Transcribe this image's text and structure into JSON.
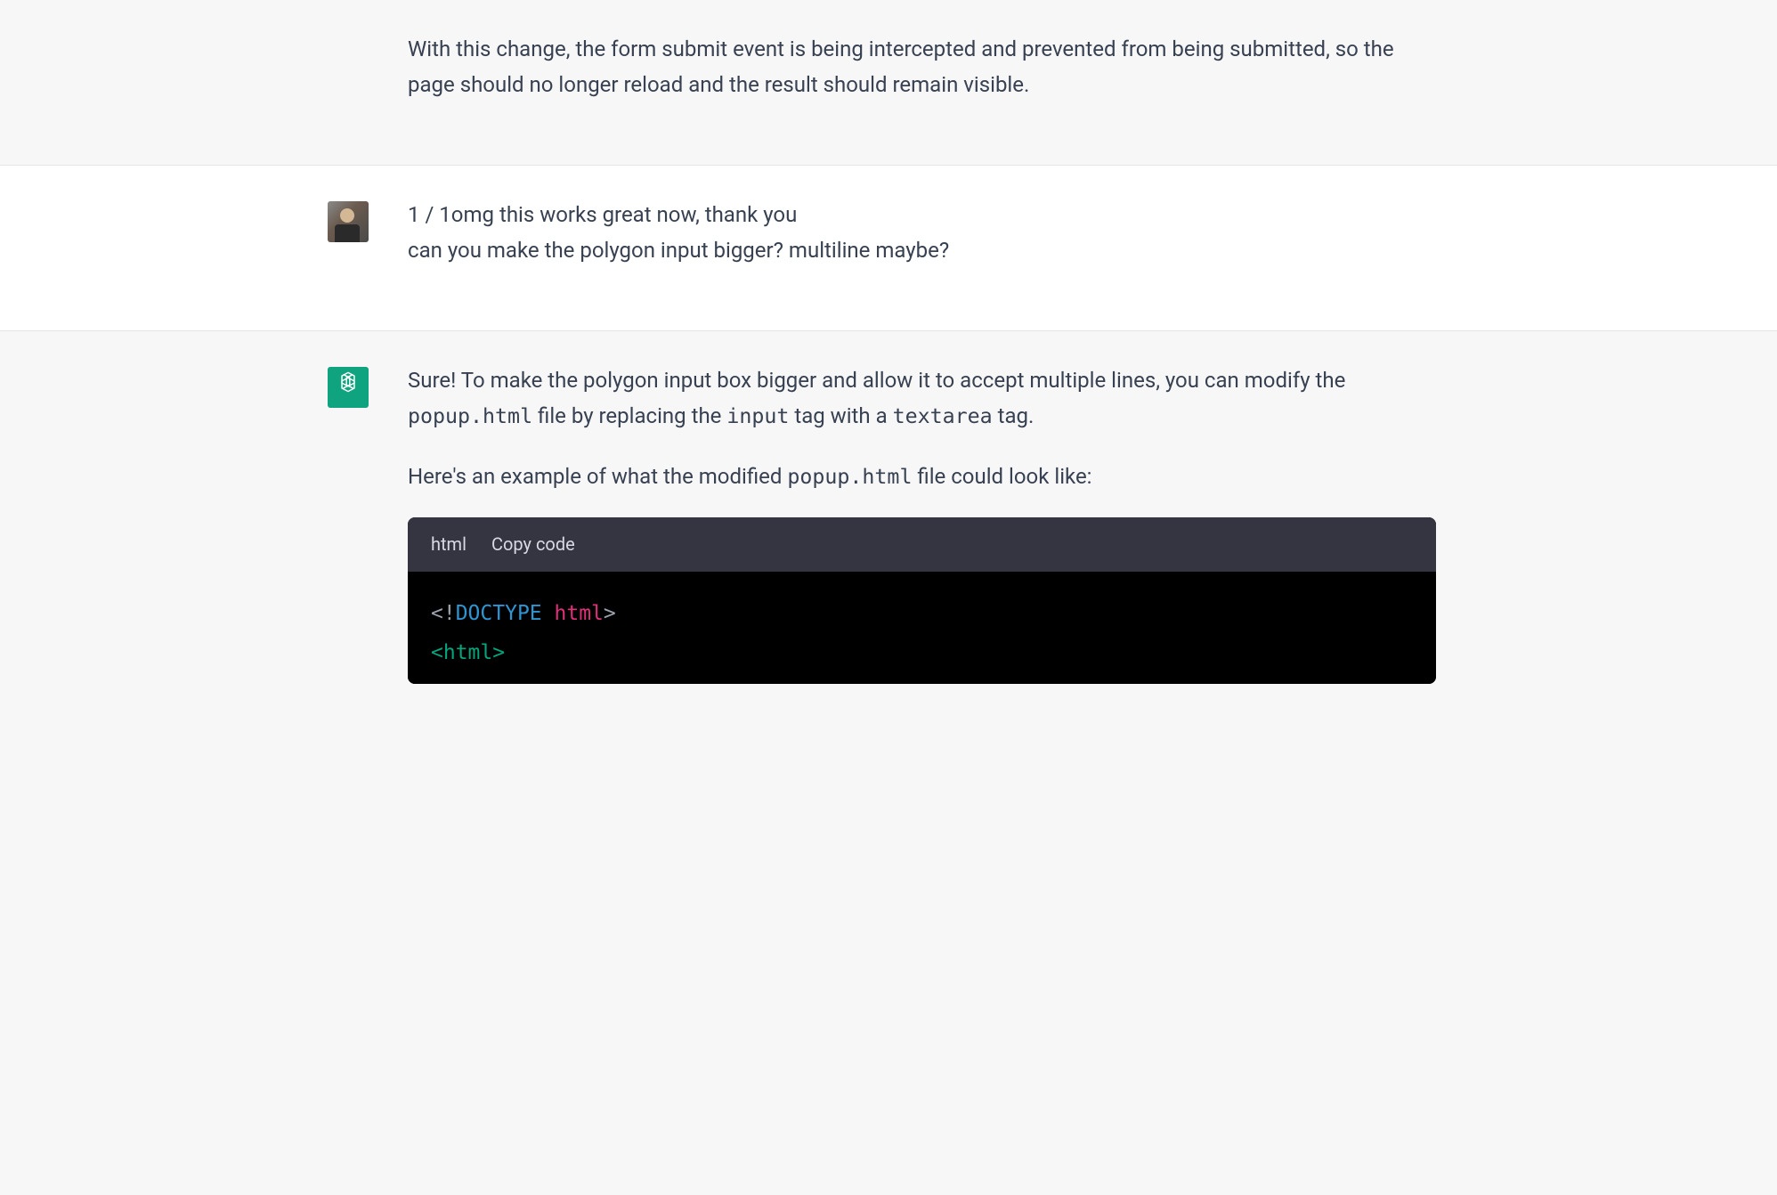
{
  "messages": {
    "assistant_prev": {
      "text": "With this change, the form submit event is being intercepted and prevented from being submitted, so the page should no longer reload and the result should remain visible."
    },
    "user": {
      "counter": "1 / 1",
      "line1_rest": "omg this works great now, thank you",
      "line2": "can you make the polygon input bigger? multiline maybe?"
    },
    "assistant": {
      "p1_a": "Sure! To make the polygon input box bigger and allow it to accept multiple lines, you can modify the ",
      "p1_code1": "popup.html",
      "p1_b": " file by replacing the ",
      "p1_code2": "input",
      "p1_c": " tag with a ",
      "p1_code3": "textarea",
      "p1_d": " tag.",
      "p2_a": "Here's an example of what the modified ",
      "p2_code1": "popup.html",
      "p2_b": " file could look like:",
      "code": {
        "lang": "html",
        "copy_label": "Copy code",
        "line1_open": "<!",
        "line1_kw": "DOCTYPE",
        "line1_sp": " ",
        "line1_name": "html",
        "line1_close": ">",
        "line2": "<html>"
      }
    }
  }
}
